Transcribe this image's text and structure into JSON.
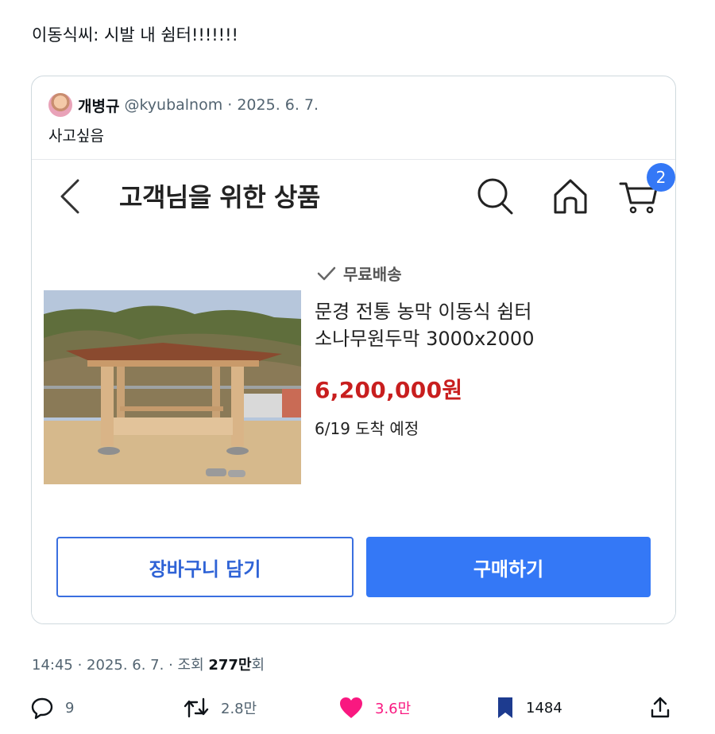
{
  "tweet": {
    "text": "이동식씨: 시발 내 쉼터!!!!!!!"
  },
  "quote": {
    "author_name": "개병규",
    "author_meta": "@kyubalnom · 2025. 6. 7.",
    "text": "사고싶음"
  },
  "shop": {
    "title": "고객님을 위한 상품",
    "cart_count": "2",
    "free_shipping": "무료배송",
    "product_name_line1": "문경 전통 농막 이동식 쉼터",
    "product_name_line2": "소나무원두막 3000x2000",
    "price": "6,200,000원",
    "delivery": "6/19 도착 예정",
    "add_to_cart": "장바구니 담기",
    "buy_now": "구매하기"
  },
  "meta": {
    "time_date": "14:45 · 2025. 6. 7. · 조회 ",
    "views": "277만",
    "views_suffix": "회"
  },
  "actions": {
    "replies": "9",
    "retweets": "2.8만",
    "likes": "3.6만",
    "bookmarks": "1484"
  },
  "colors": {
    "accent_blue": "#3478f6",
    "price_red": "#c81e1e",
    "like_pink": "#f91880",
    "muted_gray": "#536471"
  }
}
